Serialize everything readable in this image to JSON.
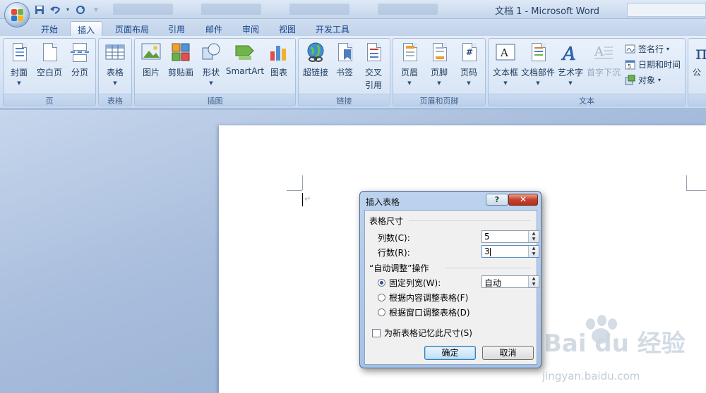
{
  "window": {
    "title": "文档 1 - Microsoft Word"
  },
  "quick_access": {
    "save_icon": "save-icon",
    "undo_icon": "undo-icon",
    "redo_icon": "redo-icon"
  },
  "tabs": [
    {
      "label": "开始"
    },
    {
      "label": "插入"
    },
    {
      "label": "页面布局"
    },
    {
      "label": "引用"
    },
    {
      "label": "邮件"
    },
    {
      "label": "审阅"
    },
    {
      "label": "视图"
    },
    {
      "label": "开发工具"
    }
  ],
  "ribbon": {
    "pages": {
      "label": "页",
      "cover": "封面",
      "blank": "空白页",
      "break": "分页"
    },
    "tables": {
      "label": "表格",
      "table": "表格"
    },
    "illustrations": {
      "label": "插图",
      "picture": "图片",
      "clipart": "剪贴画",
      "shapes": "形状",
      "smartart": "SmartArt",
      "chart": "图表"
    },
    "links": {
      "label": "链接",
      "hyperlink": "超链接",
      "bookmark": "书签",
      "cross1": "交叉",
      "cross2": "引用"
    },
    "header_footer": {
      "label": "页眉和页脚",
      "header": "页眉",
      "footer": "页脚",
      "page_number": "页码"
    },
    "text": {
      "label": "文本",
      "textbox": "文本框",
      "quickparts": "文档部件",
      "wordart": "艺术字",
      "dropcap": "首字下沉",
      "signature": "签名行",
      "datetime": "日期和时间",
      "object": "对象"
    },
    "symbols": {
      "formula": "公"
    }
  },
  "dialog": {
    "title": "插入表格",
    "help": "?",
    "close": "✕",
    "section_size": "表格尺寸",
    "cols_label": "列数(C):",
    "cols_value": "5",
    "rows_label": "行数(R):",
    "rows_value": "3",
    "section_autofit": "“自动调整”操作",
    "fixed_label": "固定列宽(W):",
    "fixed_value": "自动",
    "fit_content": "根据内容调整表格(F)",
    "fit_window": "根据窗口调整表格(D)",
    "remember": "为新表格记忆此尺寸(S)",
    "ok": "确定",
    "cancel": "取消"
  },
  "watermark": {
    "brand": "Bai du 经验",
    "url": "jingyan.baidu.com"
  }
}
